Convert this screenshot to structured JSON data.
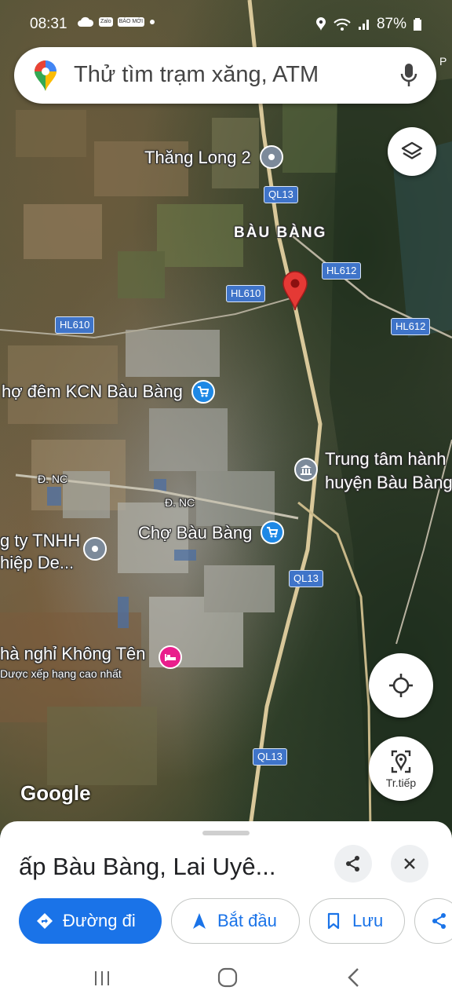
{
  "status_bar": {
    "time": "08:31",
    "left_badges": [
      "Zalo",
      "BÁO MỚI"
    ],
    "battery": "87%"
  },
  "search": {
    "placeholder": "Thử tìm trạm xăng, ATM",
    "edge_label": "P"
  },
  "map": {
    "place_labels": {
      "thang_long": "Thăng Long 2",
      "bau_bang": "BÀU BÀNG",
      "cho_dem": "hợ đêm KCN Bàu Bàng",
      "trung_tam_1": "Trung tâm hành",
      "trung_tam_2": "huyện Bàu Bàng",
      "cho_bau_bang": "Chợ Bàu Bàng",
      "cong_ty_1": "g ty TNHH",
      "cong_ty_2": "hiệp De...",
      "nha_nghi_1": "hà nghỉ Không Tên",
      "nha_nghi_2": "Dược xếp hạng cao nhất",
      "street_nc_1": "Đ. NC",
      "street_nc_2": "Đ. NC"
    },
    "road_shields": {
      "ql13_top": "QL13",
      "hl612_a": "HL612",
      "hl610_a": "HL610",
      "hl610_b": "HL610",
      "hl612_b": "HL612",
      "ql13_mid": "QL13",
      "ql13_bottom": "QL13"
    },
    "directions_fab_label": "Tr.tiếp",
    "attribution": "Google"
  },
  "sheet": {
    "title": "ấp Bàu Bàng, Lai Uyê...",
    "actions": {
      "directions": "Đường đi",
      "start": "Bắt đầu",
      "save": "Lưu"
    }
  },
  "colors": {
    "accent": "#1a73e8",
    "pin": "#e53935",
    "shield": "#3f74c9",
    "shopping_poi": "#1e88e5",
    "hotel_poi": "#e91e8c",
    "generic_poi": "#7c8a9a"
  }
}
